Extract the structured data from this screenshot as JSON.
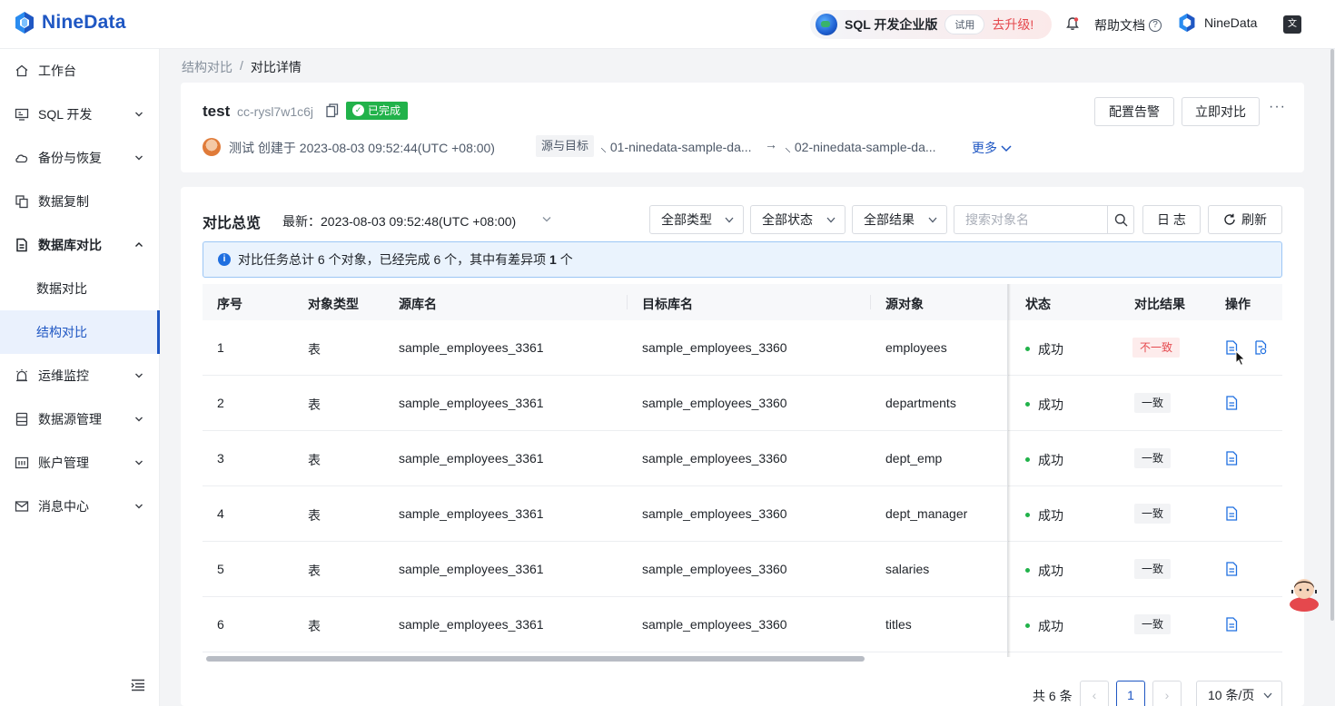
{
  "header": {
    "brand": "NineData",
    "promo": {
      "title": "SQL 开发企业版",
      "trial": "试用",
      "upgrade": "去升级!"
    },
    "help": "帮助文档",
    "user": "NineData"
  },
  "sidebar": {
    "items": [
      {
        "label": "工作台",
        "icon": "home-icon"
      },
      {
        "label": "SQL 开发",
        "icon": "monitor-icon"
      },
      {
        "label": "备份与恢复",
        "icon": "cloud-icon"
      },
      {
        "label": "数据复制",
        "icon": "copy-icon"
      },
      {
        "label": "数据库对比",
        "icon": "compare-icon"
      },
      {
        "label": "运维监控",
        "icon": "alarm-icon"
      },
      {
        "label": "数据源管理",
        "icon": "database-icon"
      },
      {
        "label": "账户管理",
        "icon": "account-icon"
      },
      {
        "label": "消息中心",
        "icon": "mail-icon"
      }
    ],
    "subitems": [
      {
        "label": "数据对比"
      },
      {
        "label": "结构对比",
        "active": true
      }
    ]
  },
  "breadcrumb": {
    "parent": "结构对比",
    "sep": "/",
    "current": "对比详情"
  },
  "task": {
    "name": "test",
    "id": "cc-rysl7w1c6j",
    "status": "已完成",
    "creator": "测试 创建于 2023-08-03 09:52:44(UTC +08:00)",
    "src_label": "源与目标",
    "source_db": "01-ninedata-sample-da...",
    "arrow": "→",
    "target_db": "02-ninedata-sample-da...",
    "more": "更多",
    "btn_alert": "配置告警",
    "btn_compare": "立即对比",
    "more_dots": "···"
  },
  "overview": {
    "title": "对比总览",
    "latest": "最新：2023-08-03 09:52:48(UTC +08:00)",
    "filters": {
      "type": "全部类型",
      "status": "全部状态",
      "result": "全部结果"
    },
    "search_placeholder": "搜索对象名",
    "btn_log": "日 志",
    "btn_refresh": "刷新",
    "info": {
      "prefix": "对比任务总计 6 个对象，已经完成 6 个，其中有差异项",
      "count": "1",
      "suffix": "个"
    }
  },
  "table": {
    "columns": [
      "序号",
      "对象类型",
      "源库名",
      "目标库名",
      "源对象",
      "状态",
      "对比结果",
      "操作"
    ],
    "rows": [
      {
        "no": "1",
        "type": "表",
        "src": "sample_employees_3361",
        "dst": "sample_employees_3360",
        "obj": "employees",
        "status": "成功",
        "result": "不一致",
        "diff": true
      },
      {
        "no": "2",
        "type": "表",
        "src": "sample_employees_3361",
        "dst": "sample_employees_3360",
        "obj": "departments",
        "status": "成功",
        "result": "一致",
        "diff": false
      },
      {
        "no": "3",
        "type": "表",
        "src": "sample_employees_3361",
        "dst": "sample_employees_3360",
        "obj": "dept_emp",
        "status": "成功",
        "result": "一致",
        "diff": false
      },
      {
        "no": "4",
        "type": "表",
        "src": "sample_employees_3361",
        "dst": "sample_employees_3360",
        "obj": "dept_manager",
        "status": "成功",
        "result": "一致",
        "diff": false
      },
      {
        "no": "5",
        "type": "表",
        "src": "sample_employees_3361",
        "dst": "sample_employees_3360",
        "obj": "salaries",
        "status": "成功",
        "result": "一致",
        "diff": false
      },
      {
        "no": "6",
        "type": "表",
        "src": "sample_employees_3361",
        "dst": "sample_employees_3360",
        "obj": "titles",
        "status": "成功",
        "result": "一致",
        "diff": false
      }
    ]
  },
  "pagination": {
    "total": "共 6 条",
    "current": "1",
    "size": "10 条/页",
    "prev": "‹",
    "next": "›"
  },
  "colors": {
    "brand": "#1f57c3",
    "success": "#21b24a",
    "danger": "#e5484d"
  }
}
